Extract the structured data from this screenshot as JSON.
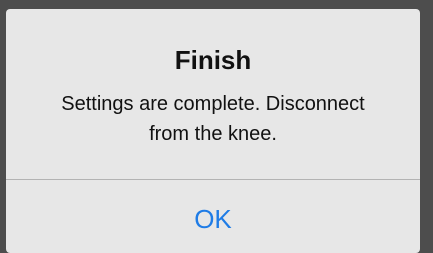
{
  "dialog": {
    "title": "Finish",
    "message": "Settings are complete. Disconnect from the knee.",
    "ok_label": "OK"
  },
  "colors": {
    "backdrop": "#4d4d4d",
    "dialog_background": "#e7e7e7",
    "divider": "#b3b3b3",
    "button_text": "#1f7ce6",
    "text": "#111111"
  }
}
